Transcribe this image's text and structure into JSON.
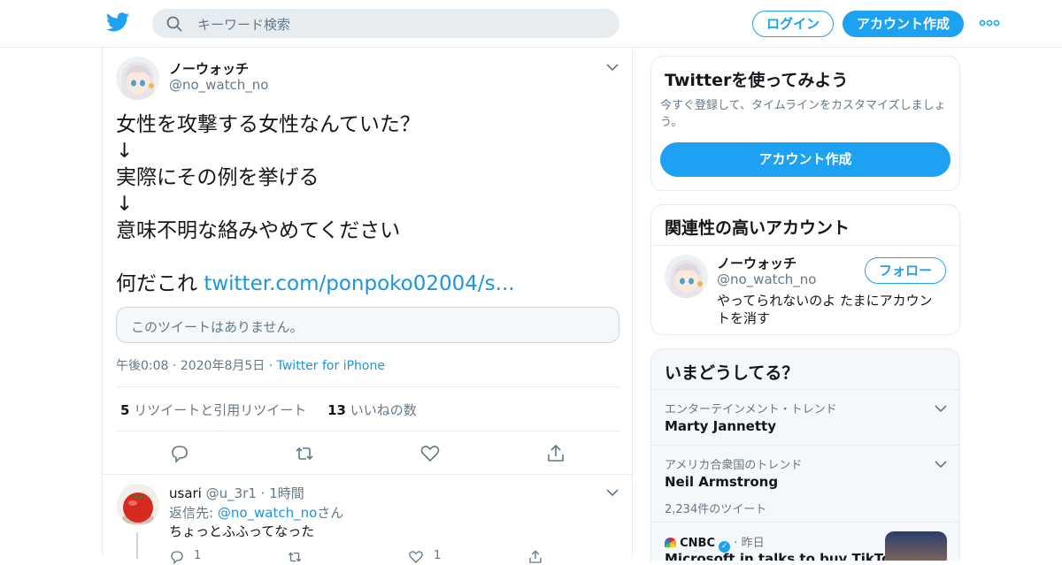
{
  "header": {
    "search_placeholder": "キーワード検索",
    "login_label": "ログイン",
    "signup_label": "アカウント作成",
    "brand_color": "#1da1f2"
  },
  "tweet": {
    "name": "ノーウォッチ",
    "handle": "@no_watch_no",
    "text_lines": [
      "女性を攻撃する女性なんていた？",
      "↓",
      "実際にその例を挙げる",
      "↓",
      "意味不明な絡みやめてください",
      "",
      "何だこれ "
    ],
    "link": "twitter.com/ponpoko02004/s...",
    "quote_unavailable": "このツイートはありません。",
    "time": "午後0:08",
    "date": "2020年8月5日",
    "source": "Twitter for iPhone",
    "retweet_count": "5",
    "retweet_label": "リツイートと引用リツイート",
    "like_count": "13",
    "like_label": "いいねの数"
  },
  "reply": {
    "name": "usari",
    "handle": "@u_3r1",
    "time": "1時間",
    "reply_to_prefix": "返信先: ",
    "reply_to_handle": "@no_watch_no",
    "reply_to_suffix": "さん",
    "text": "ちょっとふふってなった",
    "reply_count": "1",
    "like_count": "1"
  },
  "signup_card": {
    "title": "Twitterを使ってみよう",
    "description": "今すぐ登録して、タイムラインをカスタマイズしましょう。",
    "button": "アカウント作成"
  },
  "related": {
    "title": "関連性の高いアカウント",
    "name": "ノーウォッチ",
    "handle": "@no_watch_no",
    "bio": "やってられないのよ たまにアカウントを消す",
    "follow_label": "フォロー"
  },
  "trends": {
    "title": "いまどうしてる？",
    "items": [
      {
        "context": "エンターテインメント・トレンド",
        "name": "Marty Jannetty",
        "count": ""
      },
      {
        "context": "アメリカ合衆国のトレンド",
        "name": "Neil Armstrong",
        "count": "2,234件のツイート"
      }
    ],
    "news": {
      "source": "CNBC",
      "time": "昨日",
      "headline": "Microsoft in talks to buy TikTok"
    }
  }
}
